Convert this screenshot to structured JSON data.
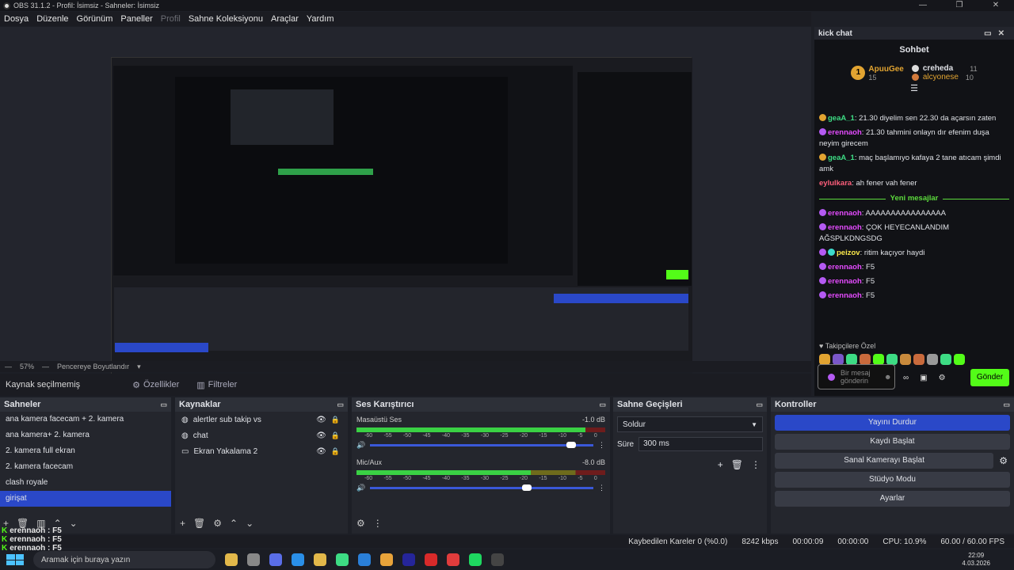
{
  "window": {
    "title": "OBS 31.1.2 - Profil: İsimsiz - Sahneler: İsimsiz"
  },
  "menu": [
    "Dosya",
    "Düzenle",
    "Görünüm",
    "Paneller",
    "Profil",
    "Sahne Koleksiyonu",
    "Araçlar",
    "Yardım"
  ],
  "zoom": {
    "level": "57%",
    "mode": "Pencereye Boyutlandır"
  },
  "source_bar": {
    "label": "Kaynak seçilmemiş",
    "properties": "Özellikler",
    "filters": "Filtreler"
  },
  "chat": {
    "dock_title": "kick chat",
    "title": "Sohbet",
    "leader1": {
      "name": "ApuuGee",
      "count": "15"
    },
    "leader2": {
      "name": "creheda",
      "count": "11"
    },
    "leader3": {
      "name": "alcyonese",
      "count": "10"
    },
    "messages": [
      {
        "user": "geaA_1",
        "text": "21.30 diyelim sen 22.30 da açarsın zaten",
        "color": "#3ddc84"
      },
      {
        "user": "erennaoh",
        "text": "21.30 tahmini onlayn dır efenim duşa neyim girecem",
        "color": "#e44bff"
      },
      {
        "user": "geaA_1",
        "text": "maç başlamıyo kafaya 2 tane atıcam şimdi amk",
        "color": "#3ddc84"
      },
      {
        "user": "eylulkara",
        "text": "ah fener vah fener",
        "color": "#ff5f7c"
      }
    ],
    "new_divider": "Yeni mesajlar",
    "messages2": [
      {
        "user": "erennaoh",
        "text": "AAAAAAAAAAAAAAAA",
        "color": "#e44bff"
      },
      {
        "user": "erennaoh",
        "text": "ÇOK HEYECANLANDIM AĞSPLKDNGSDG",
        "color": "#e44bff"
      },
      {
        "user": "peizov",
        "text": "ritim kaçıyor haydi",
        "color": "#f9e84b"
      },
      {
        "user": "erennaoh",
        "text": "F5",
        "color": "#e44bff"
      },
      {
        "user": "erennaoh",
        "text": "F5",
        "color": "#e44bff"
      },
      {
        "user": "erennaoh",
        "text": "F5",
        "color": "#e44bff"
      }
    ],
    "emotes_label": "Takipçilere Özel",
    "input_placeholder": "Bir mesaj gönderin",
    "send": "Gönder"
  },
  "scenes": {
    "title": "Sahneler",
    "items": [
      "ana kamera facecam + 2. kamera",
      "ana kamera+ 2. kamera",
      "2. kamera full ekran",
      "2. kamera  facecam",
      "clash royale",
      "girişat"
    ]
  },
  "sources": {
    "title": "Kaynaklar",
    "items": [
      "alertler sub takip vs",
      "chat",
      "Ekran Yakalama 2"
    ]
  },
  "mixer": {
    "title": "Ses Karıştırıcı",
    "channels": [
      {
        "name": "Masaüstü Ses",
        "db": "-1.0 dB"
      },
      {
        "name": "Mic/Aux",
        "db": "-8.0 dB"
      }
    ],
    "scale": [
      "-60",
      "-55",
      "-50",
      "-45",
      "-40",
      "-35",
      "-30",
      "-25",
      "-20",
      "-15",
      "-10",
      "-5",
      "0"
    ]
  },
  "transitions": {
    "title": "Sahne Geçişleri",
    "type": "Soldur",
    "duration_label": "Süre",
    "duration": "300 ms"
  },
  "controls": {
    "title": "Kontroller",
    "buttons": [
      "Yayını Durdur",
      "Kaydı Başlat",
      "Sanal Kamerayı Başlat",
      "Stüdyo Modu",
      "Ayarlar"
    ]
  },
  "status": {
    "dropped": "Kaybedilen Kareler 0 (%0.0)",
    "bitrate": "8242 kbps",
    "stream_time": "00:00:09",
    "rec_time": "00:00:00",
    "cpu": "CPU: 10.9%",
    "fps": "60.00 / 60.00 FPS"
  },
  "overlay_lines": [
    "erennaoh : F5",
    "erennaoh : F5",
    "erennaoh : F5"
  ],
  "taskbar": {
    "search": "Aramak için buraya yazın",
    "time": "22:09",
    "date": "4.03.2026"
  }
}
